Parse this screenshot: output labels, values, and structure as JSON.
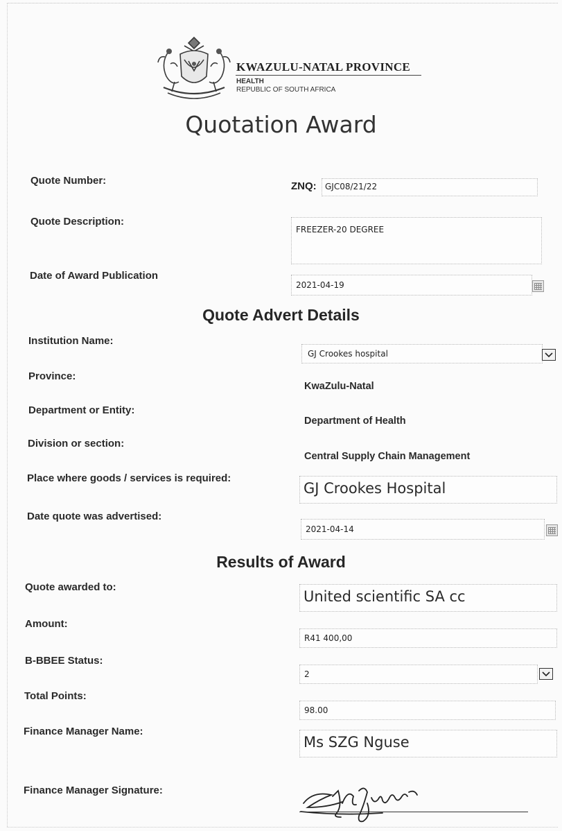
{
  "header": {
    "province_name": "KWAZULU-NATAL PROVINCE",
    "department": "HEALTH",
    "country": "REPUBLIC OF SOUTH AFRICA",
    "crest_icon": "coat-of-arms-icon"
  },
  "title": "Quotation Award",
  "quote": {
    "number_label": "Quote Number:",
    "number_prefix": "ZNQ:",
    "number_value": "GJC08/21/22",
    "description_label": "Quote Description:",
    "description_value": "FREEZER-20 DEGREE",
    "award_date_label": "Date of Award Publication",
    "award_date_value": "2021-04-19"
  },
  "advert": {
    "heading": "Quote Advert Details",
    "institution_label": "Institution Name:",
    "institution_value": "GJ Crookes hospital",
    "province_label": "Province:",
    "province_value": "KwaZulu-Natal",
    "department_label": "Department or Entity:",
    "department_value": "Department of Health",
    "division_label": "Division or section:",
    "division_value": "Central Supply Chain Management",
    "place_label": "Place where goods /  services is required:",
    "place_value": "GJ Crookes Hospital",
    "advertised_label": "Date quote was advertised:",
    "advertised_value": "2021-04-14"
  },
  "results": {
    "heading": "Results of Award",
    "awarded_label": "Quote awarded to:",
    "awarded_value": "United scientific SA cc",
    "amount_label": "Amount:",
    "amount_value": "R41 400,00",
    "bbbee_label": "B-BBEE Status:",
    "bbbee_value": "2",
    "points_label": "Total Points:",
    "points_value": "98.00",
    "manager_label": "Finance Manager Name:",
    "manager_value": "Ms SZG Nguse",
    "signature_label": "Finance Manager Signature:",
    "signature_text": "SZG Nguse"
  }
}
